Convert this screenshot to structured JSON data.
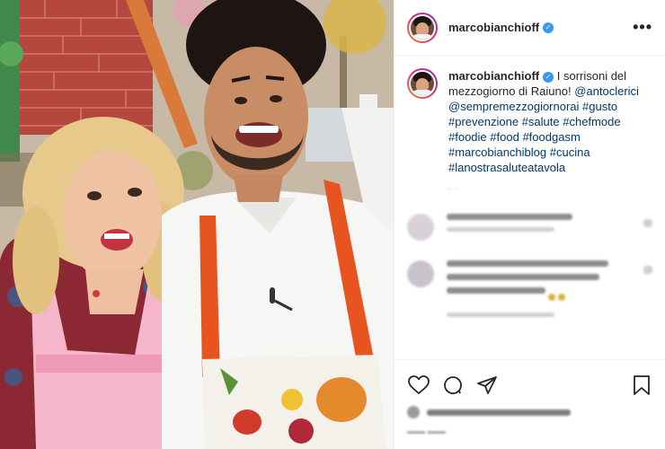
{
  "header": {
    "username": "marcobianchioff",
    "verified_glyph": "✓",
    "more_glyph": "•••"
  },
  "caption": {
    "username": "marcobianchioff",
    "verified_glyph": "✓",
    "text_1": " I sorrisoni del mezzogiorno di Raiuno! ",
    "mentions": [
      "@antoclerici",
      "@sempremezzogiornorai"
    ],
    "hashtags": [
      "#gusto",
      "#prevenzione",
      "#salute",
      "#chefmode",
      "#foodie",
      "#food",
      "#foodgasm",
      "#marcobianchiblog",
      "#cucina",
      "#lanostrasaluteatavola"
    ]
  },
  "icons": {
    "like": "heart-icon",
    "comment": "comment-icon",
    "share": "paper-plane-icon",
    "save": "bookmark-icon",
    "verified": "verified-badge-icon",
    "more": "more-options-icon"
  },
  "colors": {
    "link": "#00376b",
    "verified": "#3897f0",
    "apron_strap": "#e8541f",
    "apron_pink": "#f4b6c8"
  }
}
